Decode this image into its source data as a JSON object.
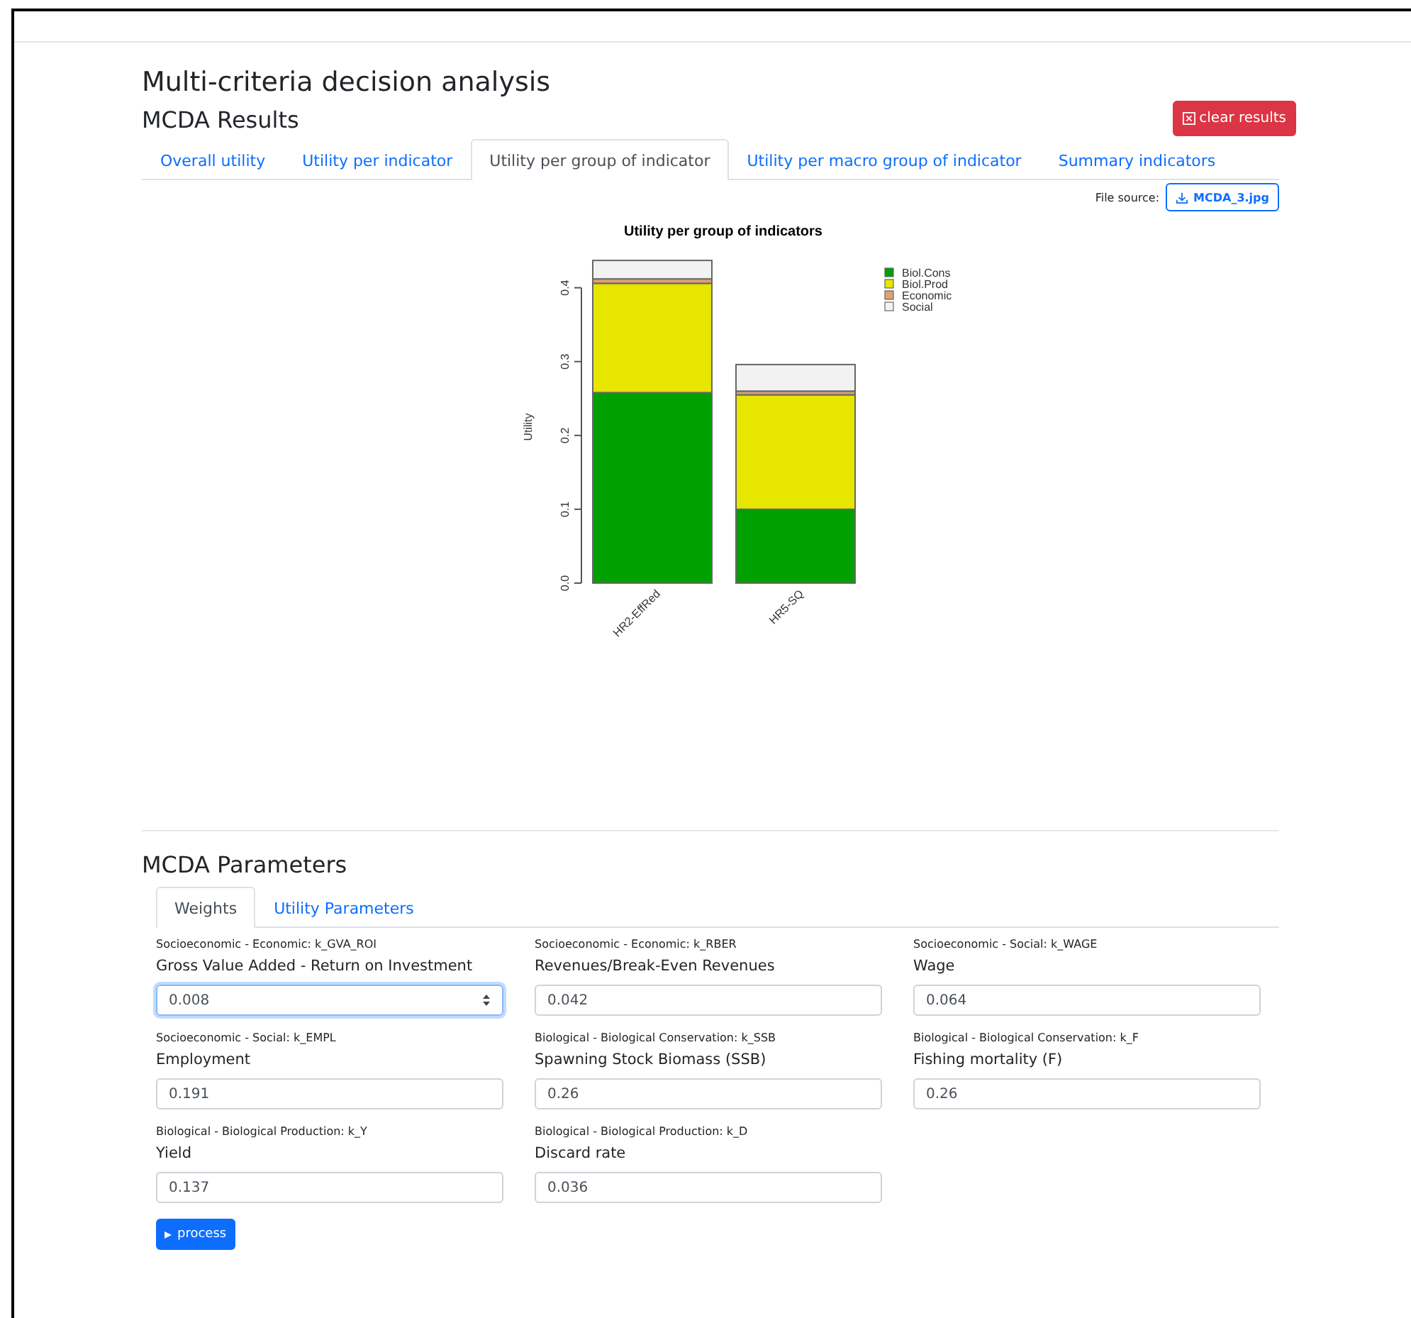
{
  "page": {
    "title": "Multi-criteria decision analysis"
  },
  "results": {
    "heading": "MCDA Results",
    "clear_button": "clear results",
    "tabs": [
      {
        "label": "Overall utility",
        "selected": false
      },
      {
        "label": "Utility per indicator",
        "selected": false
      },
      {
        "label": "Utility per group of indicator",
        "selected": true
      },
      {
        "label": "Utility per macro group of indicator",
        "selected": false
      },
      {
        "label": "Summary indicators",
        "selected": false
      }
    ],
    "file_source": {
      "label": "File source:",
      "file": "MCDA_3.jpg"
    },
    "chart_data": {
      "type": "bar",
      "title": "Utility per group of indicators",
      "ylabel": "Utility",
      "categories": [
        "HR2-EffRed",
        "HR5-SQ"
      ],
      "stacked": true,
      "ylim": [
        0,
        0.44
      ],
      "yticks": [
        {
          "value": 0,
          "label": "0.0"
        },
        0.1,
        0.2,
        0.3,
        0.4
      ],
      "legend": "topright",
      "series": [
        {
          "name": "Biol.Cons",
          "color": "#00a000",
          "values": [
            0.258,
            0.1
          ]
        },
        {
          "name": "Biol.Prod",
          "color": "#e6e600",
          "values": [
            0.148,
            0.155
          ]
        },
        {
          "name": "Economic",
          "color": "#e0a070",
          "values": [
            0.006,
            0.005
          ]
        },
        {
          "name": "Social",
          "color": "#f2f2f2",
          "values": [
            0.025,
            0.036
          ]
        }
      ]
    }
  },
  "parameters": {
    "heading": "MCDA Parameters",
    "tabs": [
      {
        "label": "Weights",
        "selected": true
      },
      {
        "label": "Utility Parameters",
        "selected": false
      }
    ],
    "fields": [
      {
        "group": "Socioeconomic - Economic: k_GVA_ROI",
        "label": "Gross Value Added - Return on Investment",
        "value": "0.008",
        "focused": true
      },
      {
        "group": "Socioeconomic - Economic: k_RBER",
        "label": "Revenues/Break-Even Revenues",
        "value": "0.042",
        "focused": false
      },
      {
        "group": "Socioeconomic - Social: k_WAGE",
        "label": "Wage",
        "value": "0.064",
        "focused": false
      },
      {
        "group": "Socioeconomic - Social: k_EMPL",
        "label": "Employment",
        "value": "0.191",
        "focused": false
      },
      {
        "group": "Biological - Biological Conservation: k_SSB",
        "label": "Spawning Stock Biomass (SSB)",
        "value": "0.26",
        "focused": false
      },
      {
        "group": "Biological - Biological Conservation: k_F",
        "label": "Fishing mortality (F)",
        "value": "0.26",
        "focused": false
      },
      {
        "group": "Biological - Biological Production: k_Y",
        "label": "Yield",
        "value": "0.137",
        "focused": false
      },
      {
        "group": "Biological - Biological Production: k_D",
        "label": "Discard rate",
        "value": "0.036",
        "focused": false
      }
    ],
    "process_button": "process"
  }
}
